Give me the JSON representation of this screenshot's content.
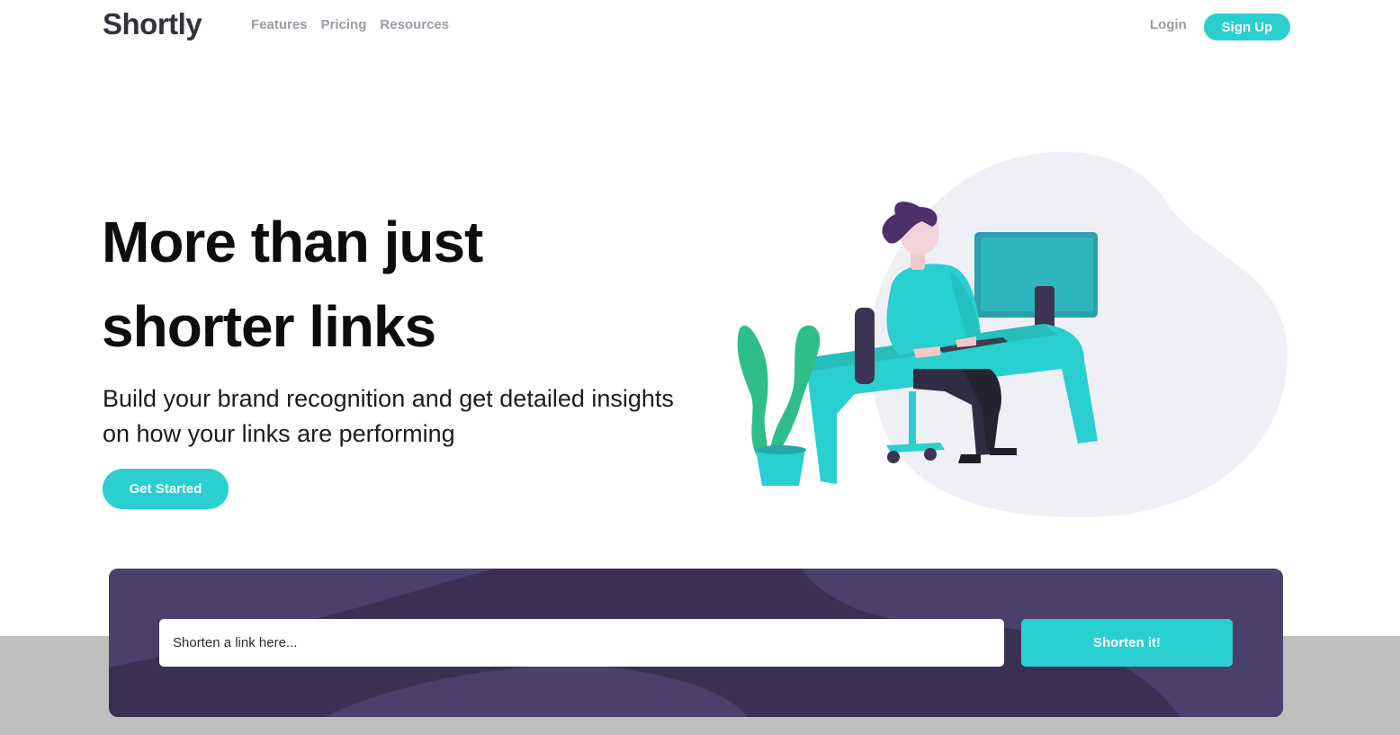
{
  "brand": {
    "name": "Shortly"
  },
  "nav": {
    "items": [
      "Features",
      "Pricing",
      "Resources"
    ]
  },
  "auth": {
    "login_label": "Login",
    "signup_label": "Sign Up"
  },
  "hero": {
    "title": "More than just shorter links",
    "subtitle": "Build your brand recognition and get detailed insights on how your links are performing",
    "cta_label": "Get Started",
    "illustration_icon": "person-working-at-desk-illustration"
  },
  "shorten": {
    "input_placeholder": "Shorten a link here...",
    "button_label": "Shorten it!"
  },
  "colors": {
    "primary_cyan": "#2acfcf",
    "dark_violet": "#3b3054",
    "gray_text": "#9e9aa7",
    "very_dark": "#34313d"
  }
}
